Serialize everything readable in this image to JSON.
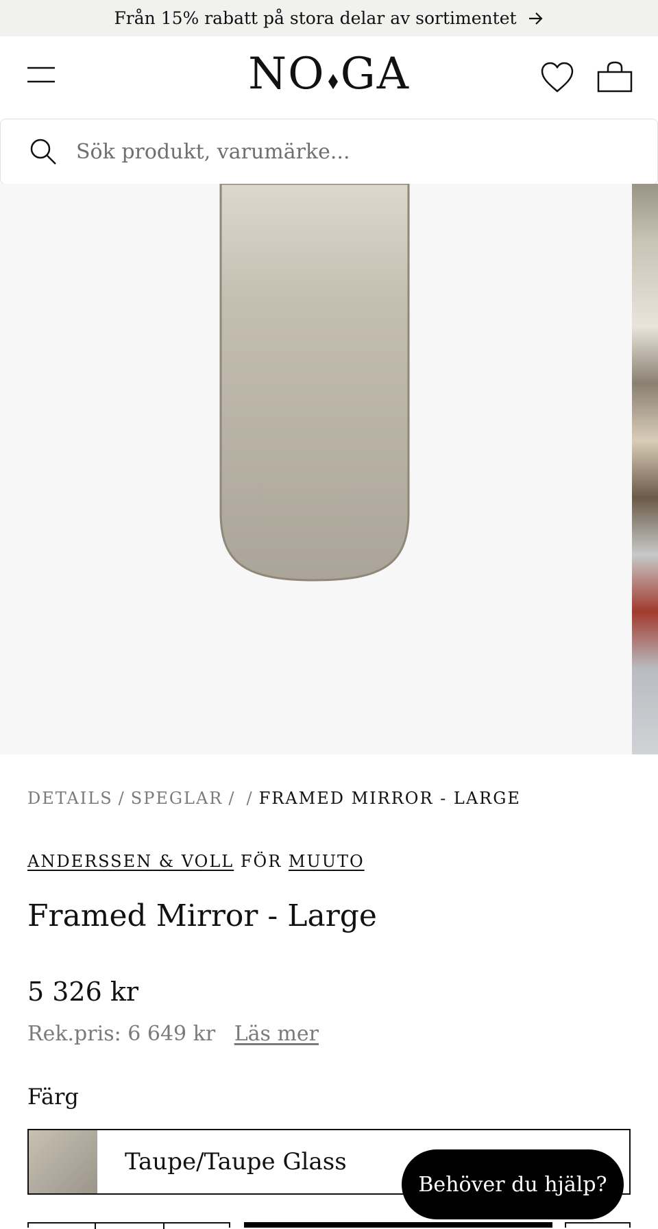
{
  "promo": {
    "text": "Från 15% rabatt på stora delar av sortimentet",
    "icon": "arrow-right-icon"
  },
  "header": {
    "logo_left": "NO",
    "logo_right": "GA",
    "icons": [
      "menu-icon",
      "heart-icon",
      "shopping-bag-icon"
    ]
  },
  "search": {
    "placeholder": "Sök produkt, varumärke...",
    "value": "",
    "icon": "search-icon"
  },
  "breadcrumb": {
    "items": [
      "DETAILS",
      "SPEGLAR",
      ""
    ],
    "current": "FRAMED MIRROR - LARGE"
  },
  "product": {
    "designer": "ANDERSSEN & VOLL",
    "connector": "FÖR",
    "brand": "MUUTO",
    "title": "Framed Mirror - Large",
    "price": "5 326 kr",
    "rrp": "Rek.pris: 6 649 kr",
    "read_more": "Läs mer"
  },
  "variant": {
    "label": "Färg",
    "selected": "Taupe/Taupe Glass"
  },
  "help": {
    "label": "Behöver du hjälp?"
  },
  "colors": {
    "promo_bg": "#f1f1ef",
    "gallery_bg": "#f7f7f7",
    "mirror": "#b7b0a3",
    "accent": "#000000"
  }
}
